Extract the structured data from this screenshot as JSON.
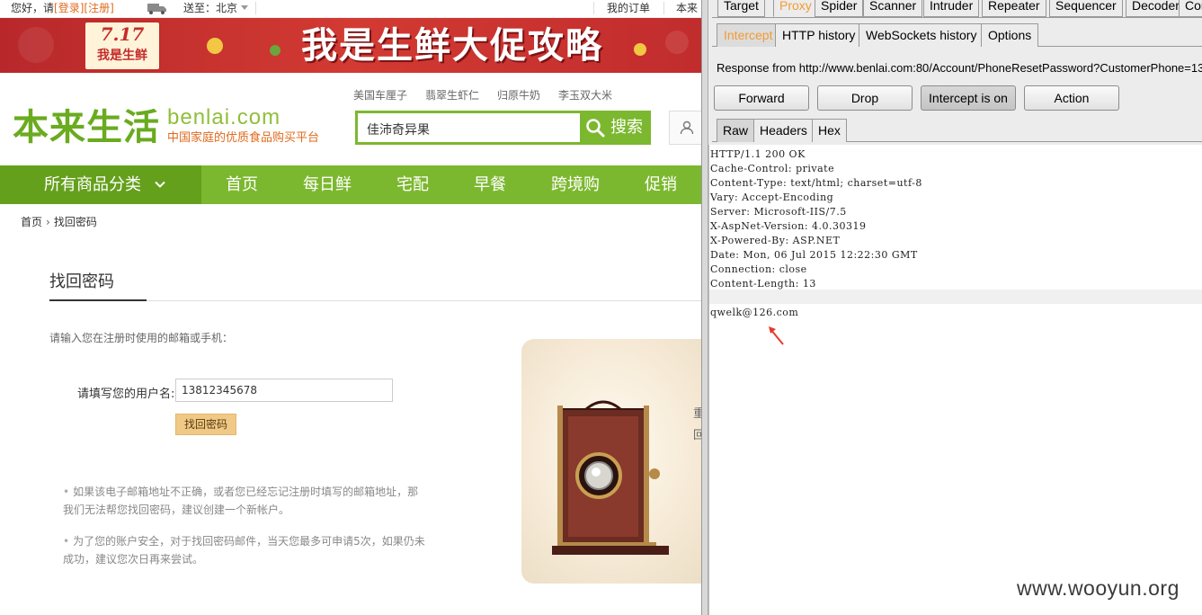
{
  "site": {
    "topbar": {
      "greeting": "您好，请",
      "login": "[登录]",
      "register": "[注册]",
      "send_to": "送至：北京",
      "my_orders": "我的订单",
      "benlai_cut": "本来"
    },
    "banner": {
      "date": "7.17",
      "sub": "我是生鲜",
      "slogan": "我是生鲜大促攻略"
    },
    "logo": {
      "cn": "本来生活",
      "en": "benlai.com",
      "tagline": "中国家庭的优质食品购买平台"
    },
    "search": {
      "hot_words": [
        "美国车厘子",
        "翡翠生虾仁",
        "归原牛奶",
        "李玉双大米"
      ],
      "value": "佳沛奇异果",
      "button": "搜索"
    },
    "nav": {
      "all_categories": "所有商品分类",
      "items": [
        "首页",
        "每日鲜",
        "宅配",
        "早餐",
        "跨境购",
        "促销"
      ]
    },
    "breadcrumb": {
      "home": "首页",
      "current": "找回密码"
    },
    "form": {
      "title": "找回密码",
      "prompt": "请输入您在注册时使用的邮箱或手机：",
      "username_label": "请填写您的用户名:",
      "username_value": "13812345678",
      "submit": "找回密码"
    },
    "notes": [
      {
        "line1": "如果该电子邮箱地址不正确，或者您已经忘记注册时填写的邮箱地址，那",
        "line2": "我们无法帮您找回密码，建议创建一个新帐户。"
      },
      {
        "line1": "为了您的账户安全，对于找回密码邮件，当天您最多可申请5次，如果仍未",
        "line2": "成功，建议您次日再来尝试。"
      }
    ],
    "photo_side": [
      "重",
      "回"
    ]
  },
  "burp": {
    "top_tabs": [
      "Target",
      "Proxy",
      "Spider",
      "Scanner",
      "Intruder",
      "Repeater",
      "Sequencer",
      "Decoder",
      "Compa"
    ],
    "active_top_tab": "Proxy",
    "sub_tabs": [
      "Intercept",
      "HTTP history",
      "WebSockets history",
      "Options"
    ],
    "active_sub_tab": "Intercept",
    "response_from": "Response from http://www.benlai.com:80/Account/PhoneResetPassword?CustomerPhone=13",
    "buttons": {
      "forward": "Forward",
      "drop": "Drop",
      "intercept": "Intercept is on",
      "action": "Action"
    },
    "view_tabs": [
      "Raw",
      "Headers",
      "Hex"
    ],
    "active_view_tab": "Raw",
    "headers": [
      "HTTP/1.1 200 OK",
      "Cache-Control: private",
      "Content-Type: text/html; charset=utf-8",
      "Vary: Accept-Encoding",
      "Server: Microsoft-IIS/7.5",
      "X-AspNet-Version: 4.0.30319",
      "X-Powered-By: ASP.NET",
      "Date: Mon, 06 Jul 2015 12:22:30 GMT",
      "Connection: close",
      "Content-Length: 13"
    ],
    "body": "qwelk@126.com"
  },
  "watermark": "www.wooyun.org",
  "colors": {
    "brand_green": "#7cb82f",
    "brand_orange": "#e06a1d",
    "burp_orange": "#f29b34",
    "banner_red": "#c12c2d"
  }
}
